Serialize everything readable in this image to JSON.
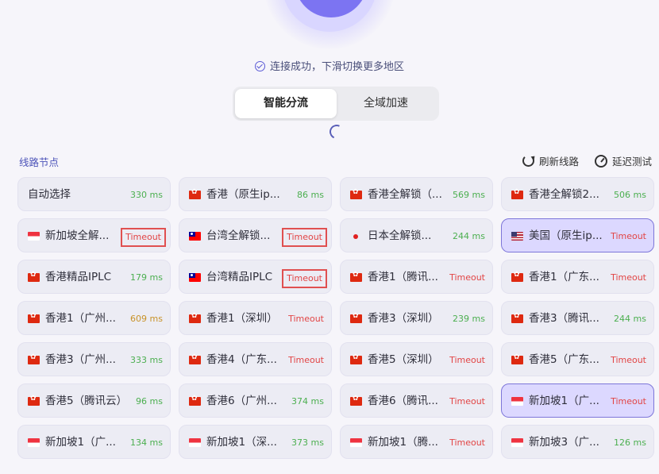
{
  "status": {
    "text": "连接成功，下滑切换更多地区"
  },
  "tabs": [
    {
      "label": "智能分流",
      "active": true
    },
    {
      "label": "全域加速",
      "active": false
    }
  ],
  "section": {
    "title": "线路节点",
    "refresh_label": "刷新线路",
    "test_label": "延迟测试"
  },
  "nodes": [
    {
      "name": "自动选择",
      "flag": "",
      "latency": "330 ms",
      "level": "good"
    },
    {
      "name": "香港（原生ip...",
      "flag": "hk",
      "latency": "86 ms",
      "level": "good"
    },
    {
      "name": "香港全解锁（...",
      "flag": "hk",
      "latency": "569 ms",
      "level": "good"
    },
    {
      "name": "香港全解锁2...",
      "flag": "hk",
      "latency": "506 ms",
      "level": "good"
    },
    {
      "name": "新加坡全解...",
      "flag": "sg",
      "latency": "Timeout",
      "level": "bad",
      "boxed": true
    },
    {
      "name": "台湾全解锁...",
      "flag": "tw",
      "latency": "Timeout",
      "level": "bad",
      "boxed": true
    },
    {
      "name": "日本全解锁...",
      "flag": "jp",
      "latency": "244 ms",
      "level": "good"
    },
    {
      "name": "美国（原生ip...",
      "flag": "us",
      "latency": "Timeout",
      "level": "bad",
      "selected": true
    },
    {
      "name": "香港精品IPLC",
      "flag": "hk",
      "latency": "179 ms",
      "level": "good"
    },
    {
      "name": "台湾精品IPLC",
      "flag": "tw",
      "latency": "Timeout",
      "level": "bad",
      "boxed": true
    },
    {
      "name": "香港1（腾讯...",
      "flag": "hk",
      "latency": "Timeout",
      "level": "bad"
    },
    {
      "name": "香港1（广东...",
      "flag": "hk",
      "latency": "Timeout",
      "level": "bad"
    },
    {
      "name": "香港1（广州...",
      "flag": "hk",
      "latency": "609 ms",
      "level": "warn"
    },
    {
      "name": "香港1（深圳）",
      "flag": "hk",
      "latency": "Timeout",
      "level": "bad"
    },
    {
      "name": "香港3（深圳）",
      "flag": "hk",
      "latency": "239 ms",
      "level": "good"
    },
    {
      "name": "香港3（腾讯...",
      "flag": "hk",
      "latency": "244 ms",
      "level": "good"
    },
    {
      "name": "香港3（广州...",
      "flag": "hk",
      "latency": "333 ms",
      "level": "good"
    },
    {
      "name": "香港4（广东...",
      "flag": "hk",
      "latency": "Timeout",
      "level": "bad"
    },
    {
      "name": "香港5（深圳）",
      "flag": "hk",
      "latency": "Timeout",
      "level": "bad"
    },
    {
      "name": "香港5（广东...",
      "flag": "hk",
      "latency": "Timeout",
      "level": "bad"
    },
    {
      "name": "香港5（腾讯云）",
      "flag": "hk",
      "latency": "96 ms",
      "level": "good"
    },
    {
      "name": "香港6（广州...",
      "flag": "hk",
      "latency": "374 ms",
      "level": "good"
    },
    {
      "name": "香港6（腾讯...",
      "flag": "hk",
      "latency": "Timeout",
      "level": "bad"
    },
    {
      "name": "新加坡1（广...",
      "flag": "sg",
      "latency": "Timeout",
      "level": "bad",
      "selected": true
    },
    {
      "name": "新加坡1（广...",
      "flag": "sg",
      "latency": "134 ms",
      "level": "good"
    },
    {
      "name": "新加坡1（深...",
      "flag": "sg",
      "latency": "373 ms",
      "level": "good"
    },
    {
      "name": "新加坡1（腾...",
      "flag": "sg",
      "latency": "Timeout",
      "level": "bad"
    },
    {
      "name": "新加坡3（广...",
      "flag": "sg",
      "latency": "126 ms",
      "level": "good"
    }
  ]
}
